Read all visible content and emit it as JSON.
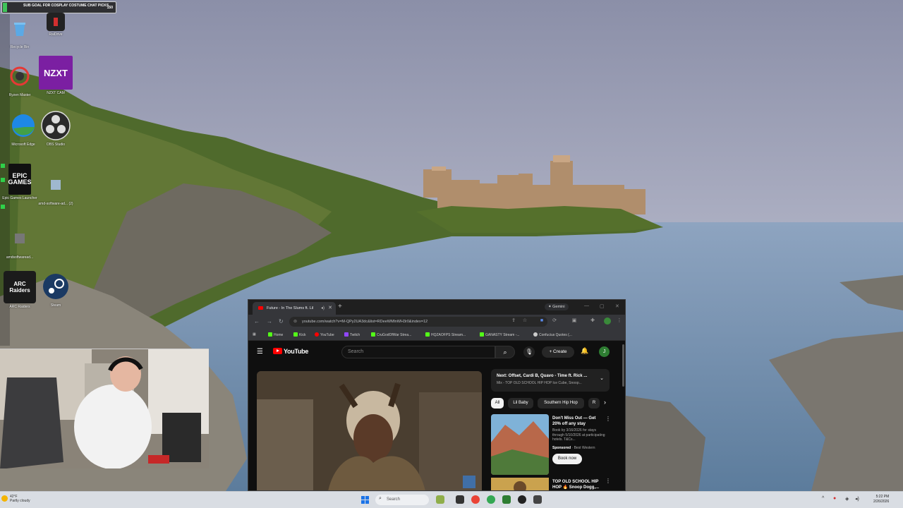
{
  "overlay": {
    "goal_text": "SUB GOAL FOR COSPLAY COSTUME CHAT PICKS",
    "goal_count": "150"
  },
  "desktop_icons": [
    {
      "label": "Recycle Bin",
      "icon": "recycle-bin-icon"
    },
    {
      "label": "RaiDrive",
      "icon": "raidrive-icon"
    },
    {
      "label": "Ryzen Master",
      "icon": "ryzen-master-icon"
    },
    {
      "label": "NZXT CAM",
      "icon": "nzxt-cam-icon",
      "glyph": "NZXT"
    },
    {
      "label": "Microsoft Edge",
      "icon": "edge-icon"
    },
    {
      "label": "OBS Studio",
      "icon": "obs-icon"
    },
    {
      "label": "Epic Games Launcher",
      "icon": "epic-games-icon",
      "glyph": "EPIC GAMES"
    },
    {
      "label": "amd-software-ad... (2)",
      "icon": "amd-software-icon"
    },
    {
      "label": "amdsoftwaread...",
      "icon": "amd-installer-icon"
    },
    {
      "label": "ARC Raiders",
      "icon": "arc-raiders-icon",
      "glyph": "ARC Raiders"
    },
    {
      "label": "Steam",
      "icon": "steam-icon"
    }
  ],
  "browser": {
    "tab_title": "Future - In The Slums ft. Lil",
    "new_tab": "+",
    "gemini_label": "Gemini",
    "url": "youtube.com/watch?v=M-QPy2UA3dc&list=RDeeWMlnWH3r0&index=12",
    "bookmarks": [
      "Home",
      "Kick",
      "YouTube",
      "Twitch",
      "CruGodOfWar Strea...",
      "HQZAOFPS Stream...",
      "GANASTY Stream -...",
      "Confucius Quotes (..."
    ]
  },
  "youtube": {
    "logo": "YouTube",
    "search_placeholder": "Search",
    "create_label": "+ Create",
    "avatar_letter": "J",
    "up_next_title": "Next: Offset, Cardi B, Quavo - Time ft. Rick ...",
    "up_next_sub": "Mix - TOP OLD SCHOOL HIP HOP Ice Cube, Snoop...",
    "chips": [
      "All",
      "Lil Baby",
      "Southern Hip Hop",
      "R"
    ],
    "ad": {
      "title": "Don't Miss Out — Get 20% off any stay",
      "desc": "Book by 3/16/2026 for stays through 5/10/2026 at participating hotels. T&Cs...",
      "sponsored": "Sponsored",
      "advertiser": "· Best Western",
      "cta": "Book now"
    },
    "next_video_title": "TOP OLD SCHOOL HIP HOP 🔥 Snoop Dogg,..."
  },
  "taskbar": {
    "weather_temp": "42°F",
    "weather_desc": "Partly cloudy",
    "search_placeholder": "Search",
    "time": "5:22 PM",
    "date": "2/26/2026"
  },
  "colors": {
    "accent": "#1a73e8",
    "youtube_red": "#ff0000"
  }
}
